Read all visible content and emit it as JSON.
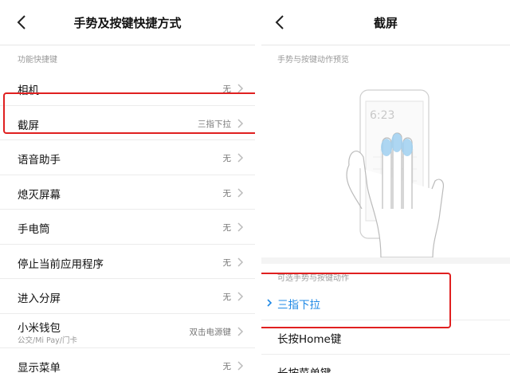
{
  "left": {
    "title": "手势及按键快捷方式",
    "section_label": "功能快捷键",
    "items": [
      {
        "label": "相机",
        "value": "无"
      },
      {
        "label": "截屏",
        "value": "三指下拉"
      },
      {
        "label": "语音助手",
        "value": "无"
      },
      {
        "label": "熄灭屏幕",
        "value": "无"
      },
      {
        "label": "手电筒",
        "value": "无"
      },
      {
        "label": "停止当前应用程序",
        "value": "无"
      },
      {
        "label": "进入分屏",
        "value": "无"
      },
      {
        "label": "小米钱包",
        "sub": "公交/Mi Pay/门卡",
        "value": "双击电源键"
      },
      {
        "label": "显示菜单",
        "value": "无"
      }
    ]
  },
  "right": {
    "title": "截屏",
    "preview_label": "手势与按键动作预览",
    "preview_time": "6:23",
    "options_label": "可选手势与按键动作",
    "options": [
      {
        "label": "三指下拉",
        "selected": true
      },
      {
        "label": "长按Home键",
        "selected": false
      },
      {
        "label": "长按菜单键",
        "selected": false
      }
    ]
  },
  "colors": {
    "accent": "#1e88e5",
    "highlight_box": "#e02020",
    "preview_fingers": "#9fd0f0"
  },
  "icons": {
    "back": "chevron-left-icon",
    "row_arrow": "chevron-right-icon",
    "selected_mark": "chevron-right-icon"
  }
}
